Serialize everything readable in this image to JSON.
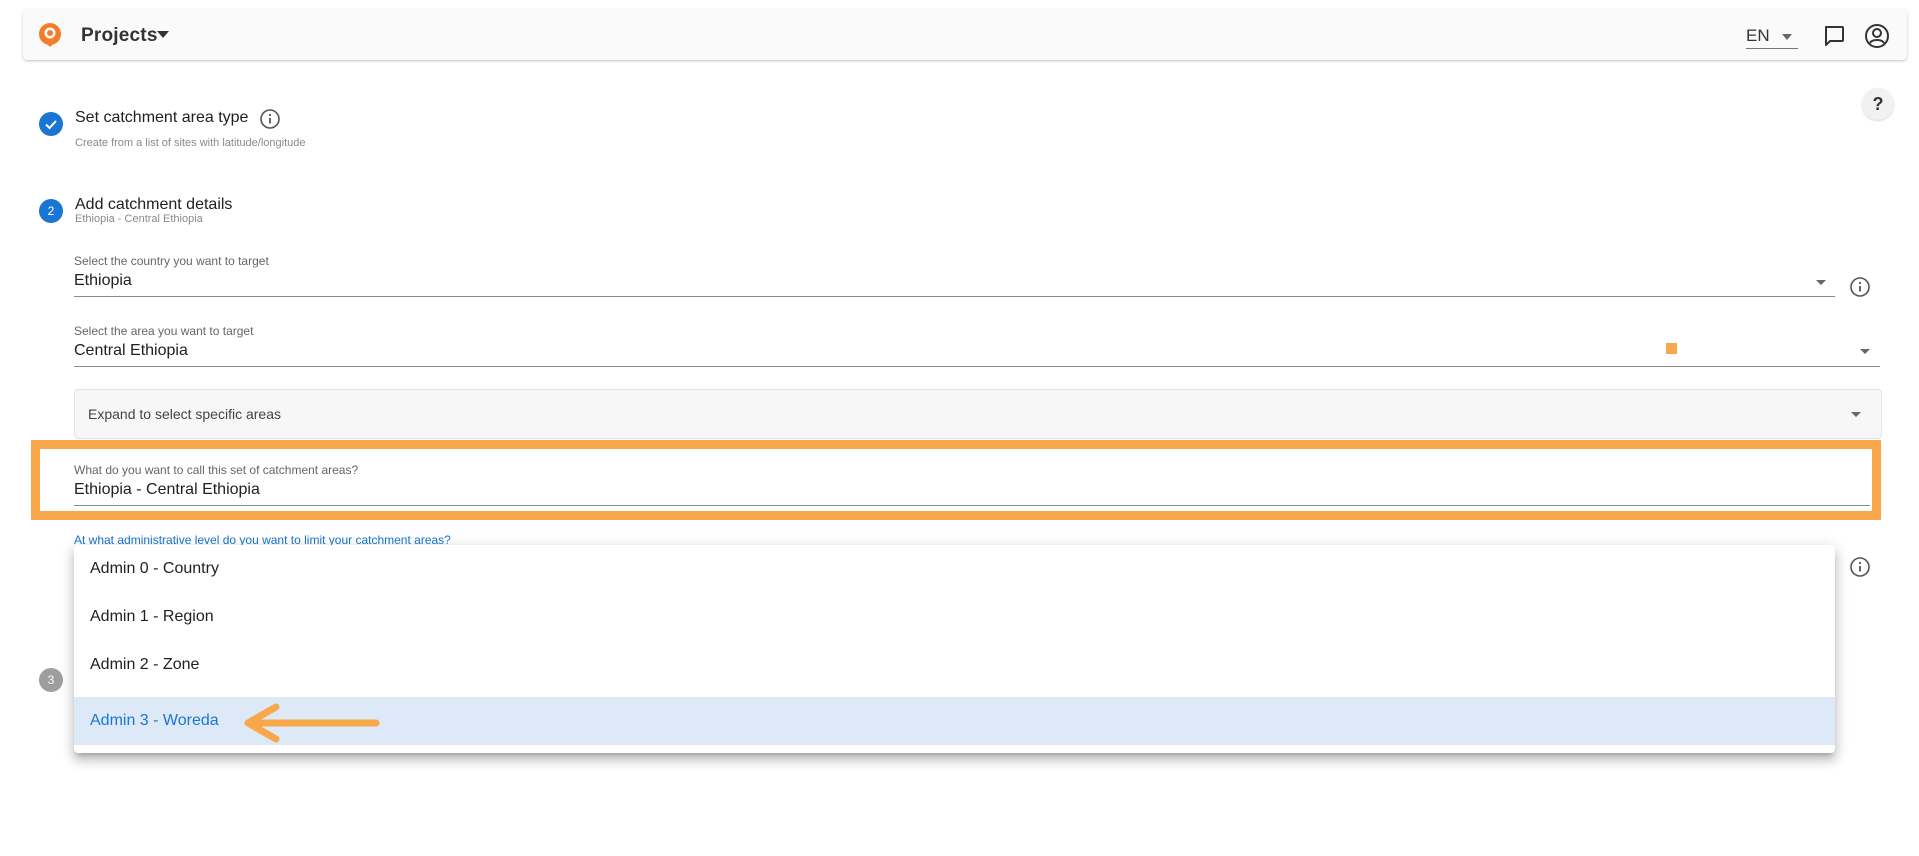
{
  "header": {
    "title": "Projects",
    "language": "EN"
  },
  "help": {
    "label": "?"
  },
  "steps": [
    {
      "number": "",
      "title": "Set catchment area type",
      "subtitle": "Create from a list of sites with latitude/longitude",
      "state": "done"
    },
    {
      "number": "2",
      "title": "Add catchment details",
      "subtitle": "Ethiopia - Central Ethiopia",
      "state": "active"
    },
    {
      "number": "3",
      "title": "",
      "subtitle": "",
      "state": "inactive"
    }
  ],
  "form": {
    "country": {
      "label": "Select the country you want to target",
      "value": "Ethiopia"
    },
    "area": {
      "label": "Select the area you want to target",
      "value": "Central Ethiopia"
    },
    "expand": {
      "label": "Expand to select specific areas"
    },
    "name": {
      "label": "What do you want to call this set of catchment areas?",
      "value": "Ethiopia - Central Ethiopia"
    },
    "admin_level": {
      "label": "At what administrative level do you want to limit your catchment areas?",
      "options": [
        "Admin 0 - Country",
        "Admin 1 - Region",
        "Admin 2 - Zone",
        "Admin 3 - Woreda"
      ],
      "selected": "Admin 3 - Woreda"
    }
  },
  "colors": {
    "accent": "#1976d2",
    "highlight": "#f8a84a",
    "selected_bg": "#dde9f6"
  }
}
